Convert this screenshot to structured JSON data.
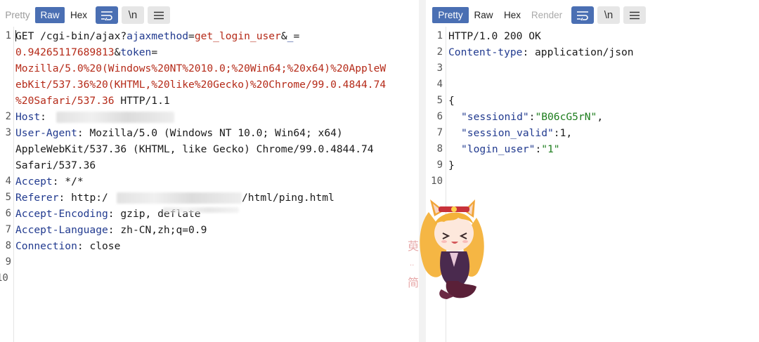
{
  "request": {
    "tabs": [
      {
        "label": "Pretty",
        "state": "inactive"
      },
      {
        "label": "Raw",
        "state": "active"
      },
      {
        "label": "Hex",
        "state": "inactive"
      }
    ],
    "icons": [
      "wrap-icon",
      "newline-icon",
      "menu-icon"
    ],
    "newline_label": "\\n",
    "line_numbers": [
      "1",
      "2",
      "3",
      "4",
      "5",
      "6",
      "7",
      "8",
      "9",
      "10"
    ],
    "lines": {
      "l1a_method": "GET /cgi-bin/ajax?",
      "l1a_k1": "ajaxmethod",
      "l1a_eq1": "=",
      "l1a_v1": "get_login_user",
      "l1a_amp": "&",
      "l1a_k2": "_",
      "l1a_eq2": "=",
      "l1b_v2": "0.94265117689813",
      "l1b_amp": "&",
      "l1b_k3": "token",
      "l1b_eq3": "=",
      "l1c": "Mozilla/5.0%20(Windows%20NT%2010.0;%20Win64;%20x64)%20AppleW",
      "l1d": "ebKit/537.36%20(KHTML,%20like%20Gecko)%20Chrome/99.0.4844.74",
      "l1e_v": "%20Safari/537.36",
      "l1e_proto": " HTTP/1.1",
      "host_key": "Host",
      "host_sep": ": ",
      "ua_key": "User-Agent",
      "ua_val1": ": Mozilla/5.0 (Windows NT 10.0; Win64; x64)",
      "ua_val2": "AppleWebKit/537.36 (KHTML, like Gecko) Chrome/99.0.4844.74",
      "ua_val3": "Safari/537.36",
      "accept_key": "Accept",
      "accept_val": ": */*",
      "referer_key": "Referer",
      "referer_val_a": ": http:/",
      "referer_val_b": "/html/ping.html",
      "enc_key": "Accept-Encoding",
      "enc_val": ": gzip, deflate",
      "lang_key": "Accept-Language",
      "lang_val": ": zh-CN,zh;q=0.9",
      "conn_key": "Connection",
      "conn_val": ": close"
    }
  },
  "response": {
    "tabs": [
      {
        "label": "Pretty",
        "state": "active"
      },
      {
        "label": "Raw",
        "state": "inactive"
      },
      {
        "label": "Hex",
        "state": "inactive"
      },
      {
        "label": "Render",
        "state": "disabled"
      }
    ],
    "newline_label": "\\n",
    "line_numbers": [
      "1",
      "2",
      "3",
      "4",
      "5",
      "6",
      "7",
      "8",
      "9",
      "10"
    ],
    "lines": {
      "status": "HTTP/1.0 200 OK",
      "ct_key": "Content-type",
      "ct_val": ": application/json",
      "brace_open": "{",
      "sid_key": "\"sessionid\"",
      "sid_colon": ":",
      "sid_val": "\"B06cG5rN\"",
      "sid_comma": ",",
      "sv_key": "\"session_valid\"",
      "sv_val": ":1,",
      "lu_key": "\"login_user\"",
      "lu_colon": ":",
      "lu_val": "\"1\"",
      "brace_close": "}"
    }
  },
  "colors": {
    "active_tab": "#4a6fb3",
    "header_key": "#213a8f",
    "param_value": "#b52a18",
    "json_string": "#1d7d1d"
  },
  "watermark": {
    "type": "anime-girl-sticker",
    "text": "萸 简"
  }
}
